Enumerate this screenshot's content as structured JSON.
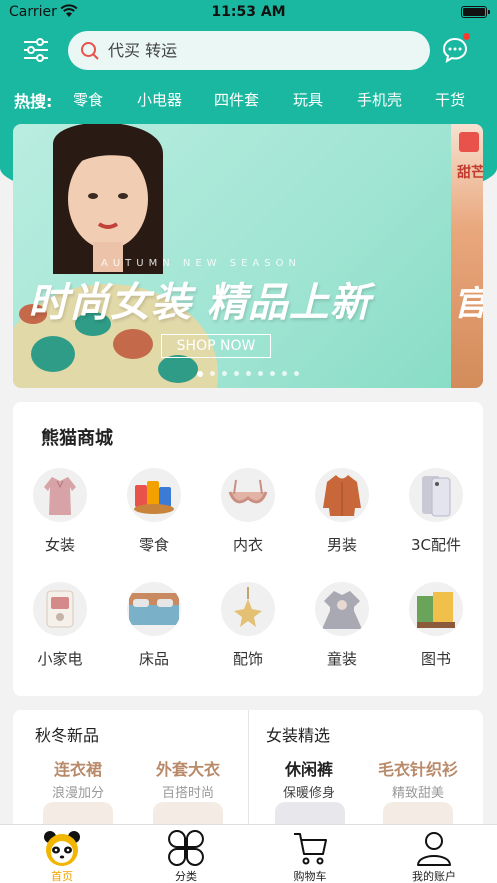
{
  "status_bar": {
    "carrier": "Carrier",
    "time": "11:53 AM"
  },
  "search": {
    "placeholder": "代买 转运"
  },
  "hot_search": {
    "label": "热搜:",
    "items": [
      "零食",
      "小电器",
      "四件套",
      "玩具",
      "手机壳",
      "干货"
    ]
  },
  "banner": {
    "season": "AUTUMN NEW SEASON",
    "slogan": "时尚女装 精品上新",
    "button": "SHOP NOW",
    "next_slide_text": "甜芒",
    "next_slide_slogan": "官方",
    "dots_count": 9,
    "active_dot": 0
  },
  "mall": {
    "title": "熊猫商城",
    "categories": [
      {
        "label": "女装",
        "icon": "blouse-icon"
      },
      {
        "label": "零食",
        "icon": "snacks-icon"
      },
      {
        "label": "内衣",
        "icon": "bra-icon"
      },
      {
        "label": "男装",
        "icon": "coat-icon"
      },
      {
        "label": "3C配件",
        "icon": "phone-icon"
      },
      {
        "label": "小家电",
        "icon": "appliance-icon"
      },
      {
        "label": "床品",
        "icon": "bed-icon"
      },
      {
        "label": "配饰",
        "icon": "brooch-icon"
      },
      {
        "label": "童装",
        "icon": "kids-dress-icon"
      },
      {
        "label": "图书",
        "icon": "books-icon"
      }
    ]
  },
  "promo": {
    "left": {
      "title": "秋冬新品",
      "items": [
        {
          "name": "连衣裙",
          "desc": "浪漫加分"
        },
        {
          "name": "外套大衣",
          "desc": "百搭时尚"
        }
      ]
    },
    "right": {
      "title": "女装精选",
      "items": [
        {
          "name": "休闲裤",
          "desc": "保暖修身"
        },
        {
          "name": "毛衣针织衫",
          "desc": "精致甜美"
        }
      ]
    },
    "colors": {
      "accent_brown": "#b98a6a",
      "dark": "#222222"
    }
  },
  "tabbar": {
    "tabs": [
      {
        "label": "首页",
        "icon": "panda-icon",
        "active": true
      },
      {
        "label": "分类",
        "icon": "category-icon",
        "active": false
      },
      {
        "label": "购物车",
        "icon": "cart-icon",
        "active": false
      },
      {
        "label": "我的账户",
        "icon": "user-icon",
        "active": false
      }
    ]
  },
  "colors": {
    "theme": "#1ab8a0",
    "active_tab": "#f2a100",
    "notification": "#ff3b30"
  }
}
